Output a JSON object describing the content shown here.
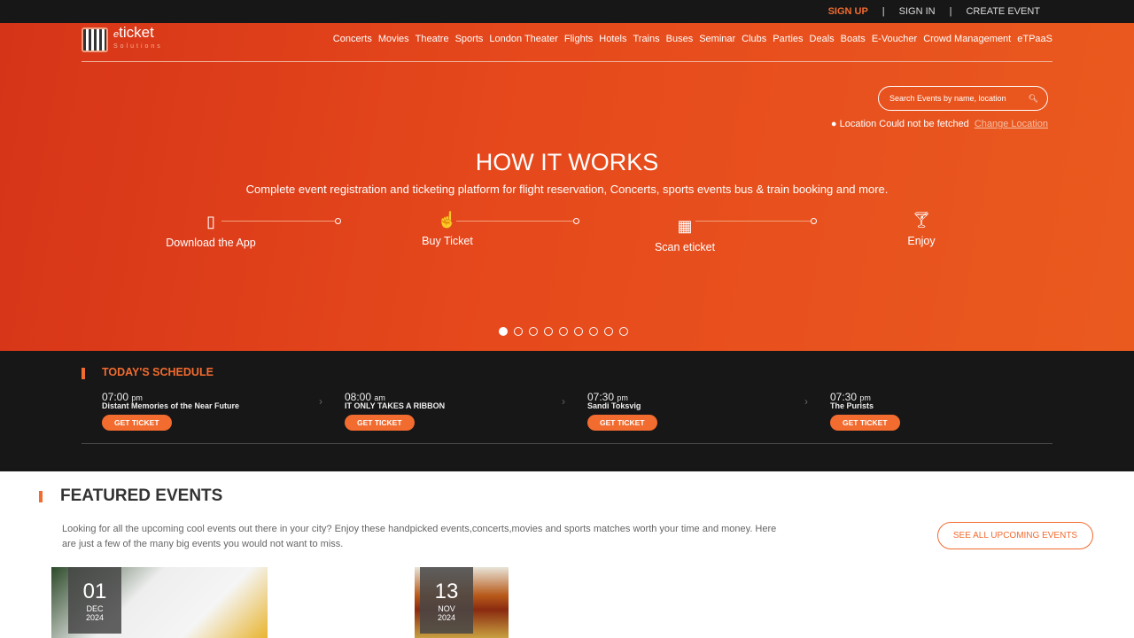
{
  "topbar": {
    "signup": "SIGN UP",
    "signin": "SIGN IN",
    "create": "CREATE EVENT",
    "sep": "|"
  },
  "logo": {
    "e": "e",
    "name": "ticket",
    "tag": "Solutions"
  },
  "nav": [
    "Concerts",
    "Movies",
    "Theatre",
    "Sports",
    "London Theater",
    "Flights",
    "Hotels",
    "Trains",
    "Buses",
    "Seminar",
    "Clubs",
    "Parties",
    "Deals",
    "Boats",
    "E-Voucher",
    "Crowd Management",
    "eTPaaS"
  ],
  "search": {
    "placeholder": "Search Events by name, location"
  },
  "location": {
    "status": "Location Could not be fetched",
    "change": "Change Location"
  },
  "hero": {
    "title": "HOW IT WORKS",
    "subtitle": "Complete event registration and ticketing platform for flight reservation, Concerts, sports events bus & train booking and more.",
    "steps": [
      "Download the App",
      "Buy Ticket",
      "Scan eticket",
      "Enjoy"
    ],
    "slide_count": 9,
    "active_slide": 1
  },
  "schedule": {
    "title": "TODAY'S SCHEDULE",
    "button": "GET TICKET",
    "items": [
      {
        "time": "07:00",
        "ampm": "pm",
        "name": "Distant Memories of the Near Future"
      },
      {
        "time": "08:00",
        "ampm": "am",
        "name": "IT ONLY TAKES A RIBBON"
      },
      {
        "time": "07:30",
        "ampm": "pm",
        "name": "Sandi Toksvig"
      },
      {
        "time": "07:30",
        "ampm": "pm",
        "name": "The Purists"
      }
    ]
  },
  "featured": {
    "title": "FEATURED EVENTS",
    "description": "Looking for all the upcoming cool events out there in your city? Enjoy these handpicked events,concerts,movies and sports matches worth your time and money. Here are just a few of the many big events you would not want to miss.",
    "see_all": "SEE ALL UPCOMING EVENTS",
    "events": [
      {
        "day": "01",
        "month": "DEC",
        "year": "2024"
      },
      {
        "day": "13",
        "month": "NOV",
        "year": "2024"
      }
    ]
  }
}
